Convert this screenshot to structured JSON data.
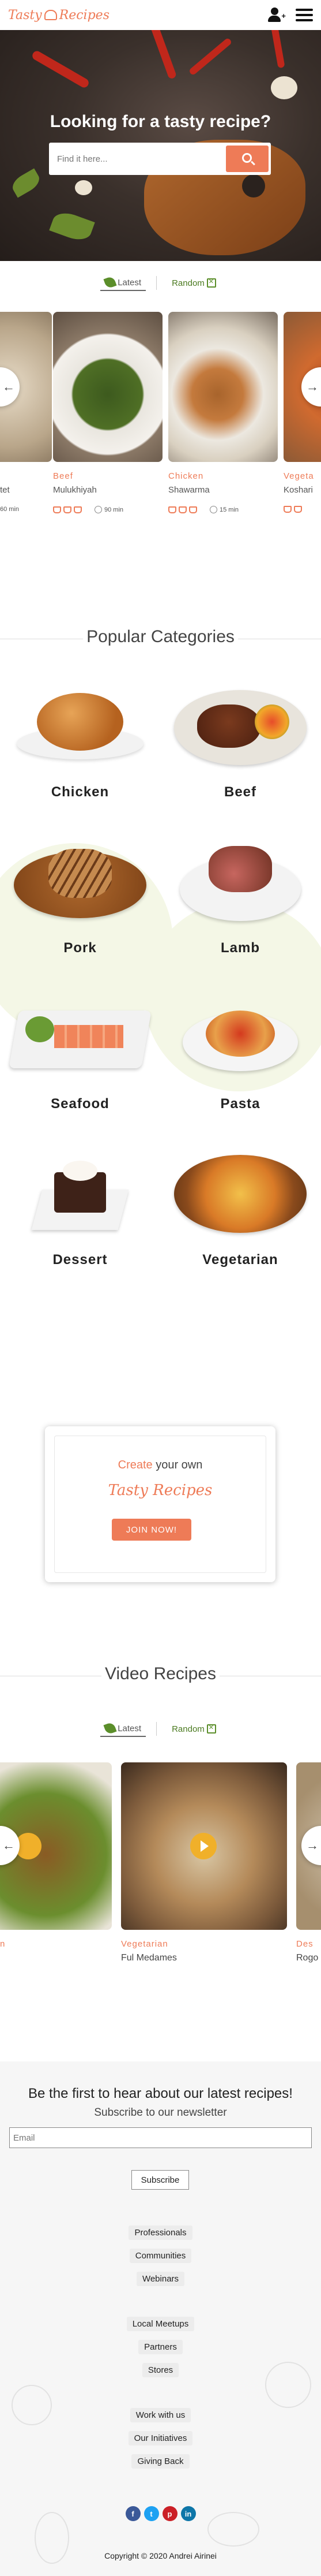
{
  "brand": {
    "name": "Tasty Recipes",
    "accent": "#ee7b57",
    "green": "#5b8e2a"
  },
  "hero": {
    "title": "Looking for a tasty recipe?",
    "search_placeholder": "Find it here..."
  },
  "tabs": {
    "latest": "Latest",
    "random": "Random"
  },
  "latest_recipes": [
    {
      "category": "",
      "name": "tet",
      "time": "60 min",
      "difficulty": 3
    },
    {
      "category": "Beef",
      "name": "Mulukhiyah",
      "time": "90 min",
      "difficulty": 3
    },
    {
      "category": "Chicken",
      "name": "Shawarma",
      "time": "15 min",
      "difficulty": 3
    },
    {
      "category": "Vegeta",
      "name": "Koshari",
      "time": "",
      "difficulty": 3
    }
  ],
  "categories_section": {
    "title": "Popular Categories",
    "items": [
      "Chicken",
      "Beef",
      "Pork",
      "Lamb",
      "Seafood",
      "Pasta",
      "Dessert",
      "Vegetarian"
    ]
  },
  "cta": {
    "create": "Create",
    "rest": "your own",
    "logo": "Tasty Recipes",
    "button": "JOIN NOW!"
  },
  "video_section": {
    "title": "Video Recipes",
    "items": [
      {
        "category": "n",
        "name": ""
      },
      {
        "category": "Vegetarian",
        "name": "Ful Medames"
      },
      {
        "category": "Des",
        "name": "Rogo"
      }
    ]
  },
  "newsletter": {
    "title": "Be the first to hear about our latest recipes!",
    "subtitle": "Subscribe to our newsletter",
    "email_placeholder": "Email",
    "button": "Subscribe"
  },
  "footer": {
    "links": [
      "Professionals",
      "Communities",
      "Webinars",
      "Local Meetups",
      "Partners",
      "Stores",
      "Work with us",
      "Our Initiatives",
      "Giving Back"
    ],
    "social": [
      "f",
      "t",
      "p",
      "in"
    ],
    "copyright": "Copyright © 2020 Andrei Airinei"
  },
  "icons": [
    "user-plus-icon",
    "hamburger-icon",
    "search-icon",
    "chevron-left-icon",
    "chevron-right-icon",
    "play-icon"
  ]
}
